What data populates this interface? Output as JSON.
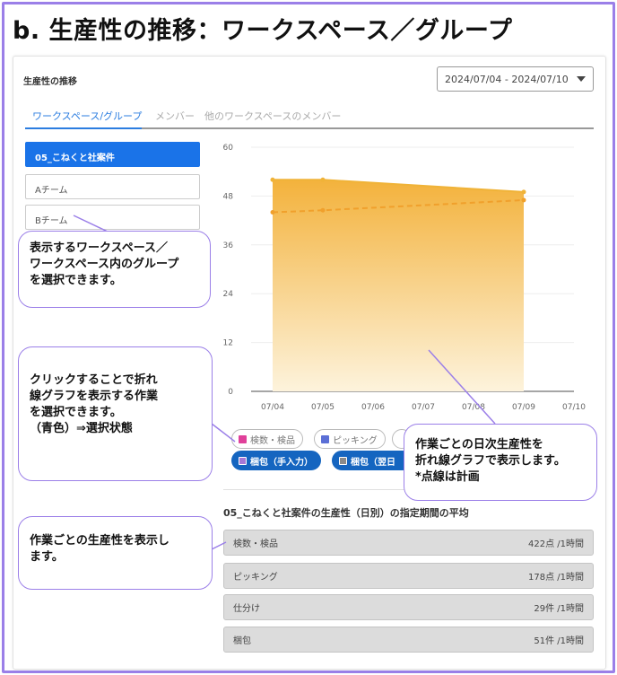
{
  "page_title": "b. 生産性の推移：ワークスペース／グループ",
  "section_title": "生産性の推移",
  "date_range": "2024/07/04 - 2024/07/10",
  "tabs": [
    {
      "label": "ワークスペース/グループ",
      "active": true
    },
    {
      "label": "メンバー",
      "active": false
    },
    {
      "label": "他のワークスペースのメンバー",
      "active": false
    }
  ],
  "groups": [
    {
      "label": "05_こねくと社案件",
      "selected": true
    },
    {
      "label": "Aチーム",
      "selected": false
    },
    {
      "label": "Bチーム",
      "selected": false
    }
  ],
  "callouts": {
    "select_group": "表示するワークスペース／\nワークスペース内のグループ\nを選択できます。",
    "select_task": "クリックすることで折れ\n線グラフを表示する作業\nを選択できます。\n（青色）⇒選択状態",
    "productivity": "作業ごとの生産性を表示し\nます。",
    "daily_chart": "作業ごとの日次生産性を\n折れ線グラフで表示します。\n*点線は計画"
  },
  "chart_data": {
    "type": "area",
    "categories": [
      "07/04",
      "07/05",
      "07/06",
      "07/07",
      "07/08",
      "07/09",
      "07/10"
    ],
    "y_ticks": [
      0,
      12,
      24,
      36,
      48,
      60
    ],
    "ylim": [
      0,
      60
    ],
    "series": [
      {
        "style": "actual",
        "x": [
          "07/04",
          "07/05",
          "07/09"
        ],
        "values": [
          52,
          52,
          49
        ],
        "color": "#f0b338"
      },
      {
        "style": "plan",
        "x": [
          "07/04",
          "07/05",
          "07/09"
        ],
        "values": [
          44,
          44.5,
          47
        ],
        "color": "#f0a02c"
      }
    ],
    "fill_top_color": "#f3b23c",
    "fill_bottom_color": "#fdf3dc"
  },
  "chips": [
    {
      "label": "検数・検品",
      "color": "#e0409a",
      "active": false
    },
    {
      "label": "ピッキング",
      "color": "#5b6fd6",
      "active": false
    },
    {
      "label": "",
      "color": "#999999",
      "active": false
    },
    {
      "label": "梱包（手入力）",
      "color": "#a678d6",
      "active": true
    },
    {
      "label": "梱包（翌日",
      "color": "#8a8a8a",
      "active": true
    }
  ],
  "avg_title": "05_こねくと社案件の生産性（日別）の指定期間の平均",
  "avg_rows": [
    {
      "label": "検数・検品",
      "value": "422点 /1時間"
    },
    {
      "label": "ピッキング",
      "value": "178点 /1時間"
    },
    {
      "label": "仕分け",
      "value": "29件 /1時間"
    },
    {
      "label": "梱包",
      "value": "51件 /1時間"
    }
  ],
  "colors": {
    "accent": "#1a73e8",
    "callout_border": "#9b7fe8",
    "tab_active": "#2b7de0"
  }
}
